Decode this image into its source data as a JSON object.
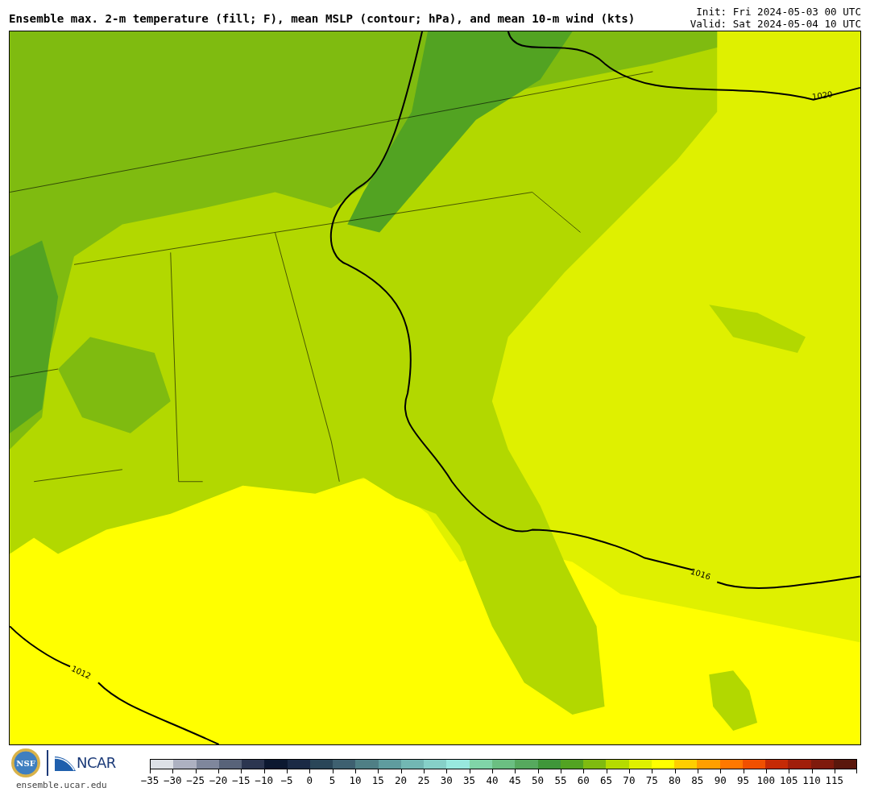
{
  "header": {
    "title": "Ensemble max. 2-m temperature (fill; F), mean MSLP (contour; hPa), and mean 10-m wind (kts)",
    "init": "Init: Fri 2024-05-03 00 UTC",
    "valid": "Valid: Sat 2024-05-04 10 UTC"
  },
  "map": {
    "contour_labels": [
      {
        "text": "1020",
        "kind": "east"
      },
      {
        "text": "1016",
        "kind": "middle"
      },
      {
        "text": "1012",
        "kind": "west"
      }
    ]
  },
  "footer": {
    "nsf_logo": "NSF",
    "ncar_logo": "NCAR",
    "url": "ensemble.ucar.edu"
  },
  "colorbar": {
    "bins": [
      {
        "color": "#dde0e6",
        "label": "−35"
      },
      {
        "color": "#adb1c1",
        "label": "−30"
      },
      {
        "color": "#7f879c",
        "label": "−25"
      },
      {
        "color": "#586379",
        "label": "−20"
      },
      {
        "color": "#2c3650",
        "label": "−15"
      },
      {
        "color": "#0c1830",
        "label": "−10"
      },
      {
        "color": "#1b2a45",
        "label": "−5"
      },
      {
        "color": "#2a4658",
        "label": "0"
      },
      {
        "color": "#3e6070",
        "label": "5"
      },
      {
        "color": "#4f7f85",
        "label": "10"
      },
      {
        "color": "#5f9c9e",
        "label": "15"
      },
      {
        "color": "#72b7b3",
        "label": "20"
      },
      {
        "color": "#86d0c8",
        "label": "25"
      },
      {
        "color": "#98e8de",
        "label": "30"
      },
      {
        "color": "#80d4a8",
        "label": "35"
      },
      {
        "color": "#6bbf82",
        "label": "40"
      },
      {
        "color": "#56a95e",
        "label": "45"
      },
      {
        "color": "#3f963a",
        "label": "50"
      },
      {
        "color": "#52a322",
        "label": "55"
      },
      {
        "color": "#7fbb10",
        "label": "60"
      },
      {
        "color": "#b5db00",
        "label": "65"
      },
      {
        "color": "#dff000",
        "label": "70"
      },
      {
        "color": "#ffff00",
        "label": "75"
      },
      {
        "color": "#ffce00",
        "label": "80"
      },
      {
        "color": "#ff9f00",
        "label": "85"
      },
      {
        "color": "#ff7800",
        "label": "90"
      },
      {
        "color": "#f05000",
        "label": "95"
      },
      {
        "color": "#c52a05",
        "label": "100"
      },
      {
        "color": "#a01e0a",
        "label": "105"
      },
      {
        "color": "#7f1a0c",
        "label": "110"
      },
      {
        "color": "#5a170c",
        "label": "115"
      }
    ]
  }
}
